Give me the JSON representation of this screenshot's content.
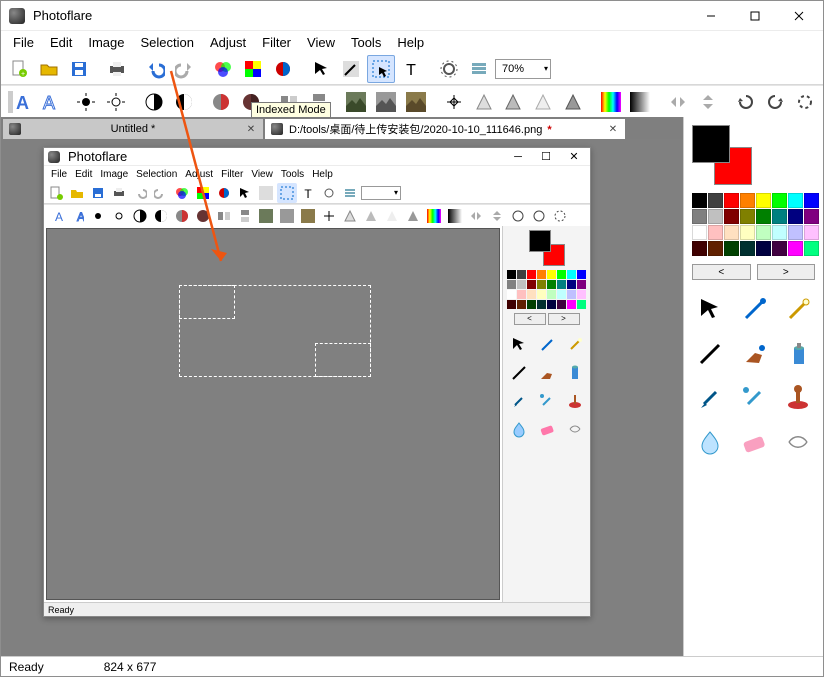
{
  "window": {
    "title": "Photoflare"
  },
  "menu": [
    "File",
    "Edit",
    "Image",
    "Selection",
    "Adjust",
    "Filter",
    "View",
    "Tools",
    "Help"
  ],
  "toolbar": {
    "zoom": "70%",
    "tooltip": "Indexed Mode"
  },
  "tabs": [
    {
      "label": "Untitled *",
      "active": false,
      "dirty": true,
      "icon": true
    },
    {
      "label": "D:/tools/桌面/待上传安装包/2020-10-10_111646.png ",
      "active": true,
      "dirty": true,
      "icon": true
    }
  ],
  "palette": [
    "#000000",
    "#404040",
    "#ff0000",
    "#ff8000",
    "#ffff00",
    "#00ff00",
    "#00ffff",
    "#0000ff",
    "#808080",
    "#c0c0c0",
    "#800000",
    "#808000",
    "#008000",
    "#008080",
    "#000080",
    "#800080",
    "#ffffff",
    "#ffc0c0",
    "#ffe0c0",
    "#ffffc0",
    "#c0ffc0",
    "#c0ffff",
    "#c0c0ff",
    "#ffc0ff",
    "#400000",
    "#602000",
    "#004000",
    "#003030",
    "#000040",
    "#400040",
    "#ff00ff",
    "#00ff80"
  ],
  "innerPalette": [
    "#000000",
    "#404040",
    "#ff0000",
    "#ff8000",
    "#ffff00",
    "#00ff00",
    "#00ffff",
    "#0000ff",
    "#808080",
    "#c0c0c0",
    "#800000",
    "#808000",
    "#008000",
    "#008080",
    "#000080",
    "#800080",
    "#ffffff",
    "#ffc0c0",
    "#ffe0c0",
    "#ffffc0",
    "#c0ffc0",
    "#c0ffff",
    "#c0c0ff",
    "#ffc0ff",
    "#400000",
    "#602000",
    "#004000",
    "#003030",
    "#000040",
    "#400040",
    "#ff00ff",
    "#00ff80"
  ],
  "innerWindow": {
    "title": "Photoflare",
    "status": "Ready"
  },
  "statusbar": {
    "ready": "Ready",
    "dims": "824 x 677"
  },
  "scrollbuttons": {
    "left": "<",
    "right": ">"
  }
}
